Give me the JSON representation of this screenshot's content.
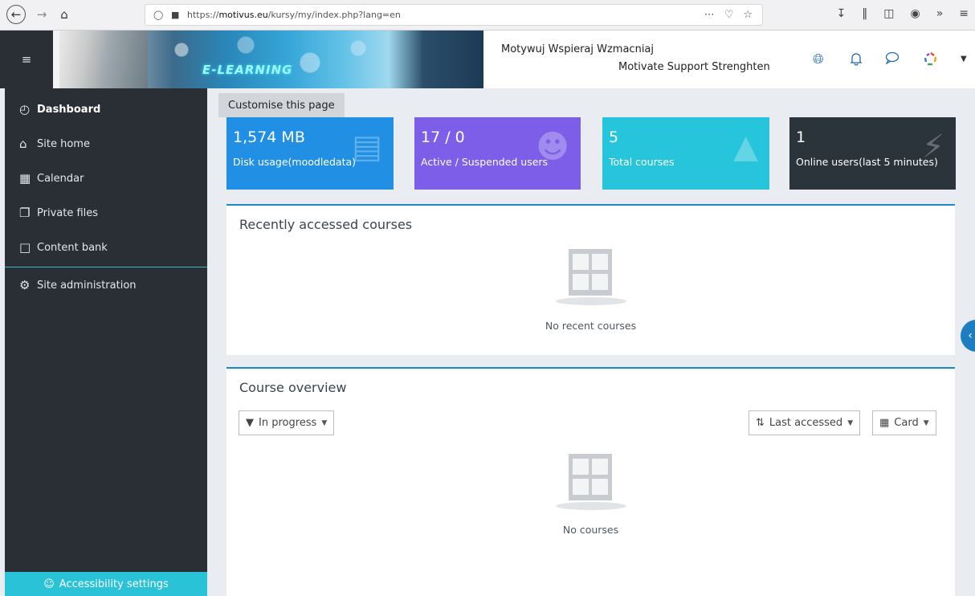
{
  "browser": {
    "url_prefix": "https://",
    "url_domain": "motivus.eu",
    "url_path": "/kursy/my/index.php?lang=en"
  },
  "header": {
    "banner_text": "E-LEARNING",
    "tagline_pl": "Motywuj Wspieraj Wzmacniaj",
    "tagline_en": "Motivate Support Strenghten"
  },
  "sidebar": {
    "items": [
      {
        "label": "Dashboard",
        "icon": "gauge-icon"
      },
      {
        "label": "Site home",
        "icon": "home-icon"
      },
      {
        "label": "Calendar",
        "icon": "calendar-icon"
      },
      {
        "label": "Private files",
        "icon": "files-icon"
      },
      {
        "label": "Content bank",
        "icon": "clipboard-icon"
      },
      {
        "label": "Site administration",
        "icon": "gear-icon"
      }
    ],
    "accessibility_label": "Accessibility settings"
  },
  "main": {
    "customise_label": "Customise this page",
    "tiles": [
      {
        "value": "1,574 MB",
        "label": "Disk usage(moodledata)",
        "color": "#2190e4"
      },
      {
        "value": "17 / 0",
        "label": "Active / Suspended users",
        "color": "#7c5ee8"
      },
      {
        "value": "5",
        "label": "Total courses",
        "color": "#27c5dc"
      },
      {
        "value": "1",
        "label": "Online users(last 5 minutes)",
        "color": "#2b333b"
      }
    ],
    "recent": {
      "title": "Recently accessed courses",
      "empty_text": "No recent courses"
    },
    "overview": {
      "title": "Course overview",
      "filter_label": "In progress",
      "sort_label": "Last accessed",
      "view_label": "Card",
      "empty_text": "No courses"
    }
  },
  "colors": {
    "sidebar_bg": "#2a2f36",
    "accent": "#1a8bc2",
    "accessibility_bg": "#29c2d6"
  }
}
